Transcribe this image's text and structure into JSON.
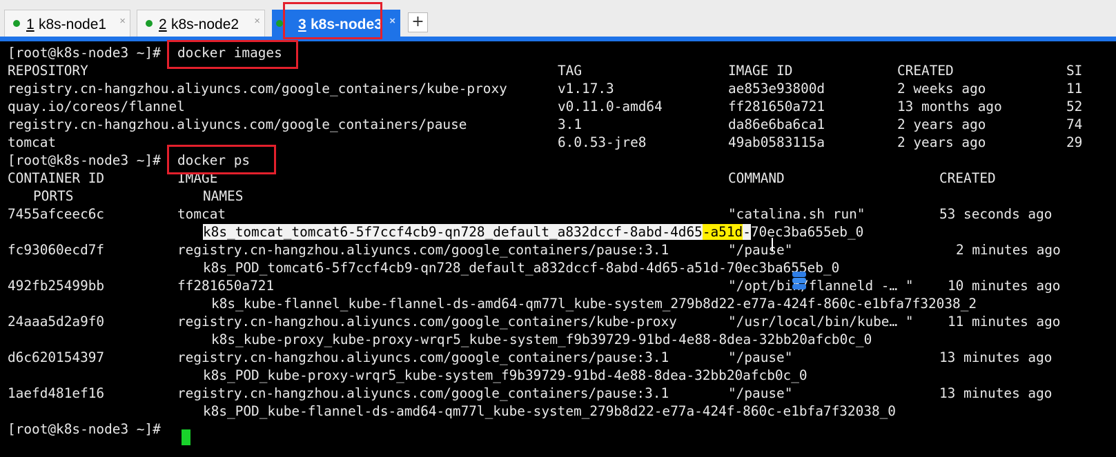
{
  "tabs": [
    {
      "number": "1",
      "label": "k8s-node1",
      "close": "×"
    },
    {
      "number": "2",
      "label": "k8s-node2",
      "close": "×"
    },
    {
      "number": "3",
      "label": "k8s-node3",
      "close": "×"
    }
  ],
  "add_tab_label": "+",
  "colors": {
    "tab_accent": "#1e73e8",
    "status_dot": "#1a9e2a",
    "annotation_box": "#e3202c",
    "cursor": "#19d22b",
    "highlight": "#ffee00"
  },
  "terminal": {
    "prompt": "[root@k8s-node3 ~]#",
    "cmd1": "docker images",
    "images_header": {
      "repository": "REPOSITORY",
      "tag": "TAG",
      "image_id": "IMAGE ID",
      "created": "CREATED",
      "size_trunc": "SI"
    },
    "images": [
      {
        "repository": "registry.cn-hangzhou.aliyuncs.com/google_containers/kube-proxy",
        "tag": "v1.17.3",
        "image_id": "ae853e93800d",
        "created": "2 weeks ago",
        "size_trunc": "11"
      },
      {
        "repository": "quay.io/coreos/flannel",
        "tag": "v0.11.0-amd64",
        "image_id": "ff281650a721",
        "created": "13 months ago",
        "size_trunc": "52"
      },
      {
        "repository": "registry.cn-hangzhou.aliyuncs.com/google_containers/pause",
        "tag": "3.1",
        "image_id": "da86e6ba6ca1",
        "created": "2 years ago",
        "size_trunc": "74"
      },
      {
        "repository": "tomcat",
        "tag": "6.0.53-jre8",
        "image_id": "49ab0583115a",
        "created": "2 years ago",
        "size_trunc": "29"
      }
    ],
    "cmd2": "docker ps",
    "ps_header": {
      "container_id": "CONTAINER ID",
      "image": "IMAGE",
      "command": "COMMAND",
      "created": "CREATED",
      "ports": "PORTS",
      "names": "NAMES"
    },
    "containers": [
      {
        "id": "7455afceec6c",
        "image": "tomcat",
        "command": "\"catalina.sh run\"",
        "created": "53 seconds ago",
        "name_a": "k8s_tomcat_tomcat6-5f7ccf4cb9-qn728_default_a832dccf-8abd-4d65",
        "name_b": "-a51d",
        "name_c": "-",
        "name_d": "70ec3ba655eb_0"
      },
      {
        "id": "fc93060ecd7f",
        "image": "registry.cn-hangzhou.aliyuncs.com/google_containers/pause:3.1",
        "command": "\"/pause\"",
        "created": "2 minutes ago",
        "name": "k8s_POD_tomcat6-5f7ccf4cb9-qn728_default_a832dccf-8abd-4d65-a51d-70ec3ba655eb_0"
      },
      {
        "id": "492fb25499bb",
        "image": "ff281650a721",
        "command": "\"/opt/bin/flanneld -… \"",
        "created": "10 minutes ago",
        "name": "k8s_kube-flannel_kube-flannel-ds-amd64-qm77l_kube-system_279b8d22-e77a-424f-860c-e1bfa7f32038_2"
      },
      {
        "id": "24aaa5d2a9f0",
        "image": "registry.cn-hangzhou.aliyuncs.com/google_containers/kube-proxy",
        "command": "\"/usr/local/bin/kube… \"",
        "created": "11 minutes ago",
        "name": "k8s_kube-proxy_kube-proxy-wrqr5_kube-system_f9b39729-91bd-4e88-8dea-32bb20afcb0c_0"
      },
      {
        "id": "d6c620154397",
        "image": "registry.cn-hangzhou.aliyuncs.com/google_containers/pause:3.1",
        "command": "\"/pause\"",
        "created": "13 minutes ago",
        "name": "k8s_POD_kube-proxy-wrqr5_kube-system_f9b39729-91bd-4e88-8dea-32bb20afcb0c_0"
      },
      {
        "id": "1aefd481ef16",
        "image": "registry.cn-hangzhou.aliyuncs.com/google_containers/pause:3.1",
        "command": "\"/pause\"",
        "created": "13 minutes ago",
        "name": "k8s_POD_kube-flannel-ds-amd64-qm77l_kube-system_279b8d22-e77a-424f-860c-e1bfa7f32038_0"
      }
    ]
  }
}
